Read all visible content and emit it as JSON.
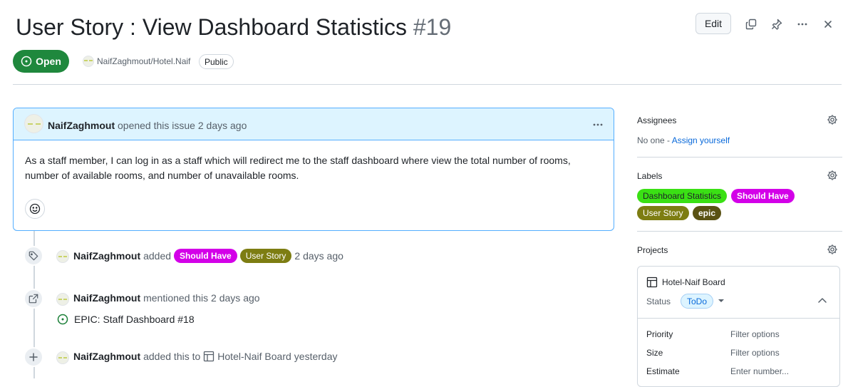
{
  "issue": {
    "title": "User Story : View Dashboard Statistics",
    "number": "#19",
    "state": "Open",
    "repo": "NaifZaghmout/Hotel.Naif",
    "visibility": "Public"
  },
  "header_actions": {
    "edit_label": "Edit",
    "icons": [
      "copy-link-icon",
      "pin-icon",
      "more-options-icon",
      "close-icon"
    ]
  },
  "comment": {
    "author": "NaifZaghmout",
    "action": "opened this issue 2 days ago",
    "body": "As a staff member, I can log in as a staff which will redirect me to the staff dashboard where view the total number of rooms, number of available rooms, and number of unavailable rooms."
  },
  "timeline": [
    {
      "icon": "tag-icon",
      "author": "NaifZaghmout",
      "action": "added",
      "labels": [
        "Should Have",
        "User Story"
      ],
      "time": "2 days ago"
    },
    {
      "icon": "cross-reference-icon",
      "author": "NaifZaghmout",
      "action": "mentioned this 2 days ago",
      "reference": "EPIC: Staff Dashboard #18"
    },
    {
      "icon": "plus-icon",
      "author": "NaifZaghmout",
      "action": "added this to",
      "project": "Hotel-Naif Board",
      "time": "yesterday"
    }
  ],
  "sidebar": {
    "assignees": {
      "title": "Assignees",
      "none": "No one -",
      "assign_link": "Assign yourself"
    },
    "labels": {
      "title": "Labels",
      "items": [
        "Dashboard Statistics",
        "Should Have",
        "User Story",
        "epic"
      ]
    },
    "projects": {
      "title": "Projects",
      "board_name": "Hotel-Naif Board",
      "status_label": "Status",
      "status_value": "ToDo",
      "fields": [
        {
          "label": "Priority",
          "value": "Filter options"
        },
        {
          "label": "Size",
          "value": "Filter options"
        },
        {
          "label": "Estimate",
          "value": "Enter number..."
        }
      ]
    }
  },
  "colors": {
    "open_green": "#1f883d",
    "should_have": "#d300e8",
    "user_story": "#7d7d12",
    "dashboard_statistics": "#3ae014",
    "epic": "#5a5214",
    "link_blue": "#0969da",
    "comment_header": "#ddf4ff"
  }
}
